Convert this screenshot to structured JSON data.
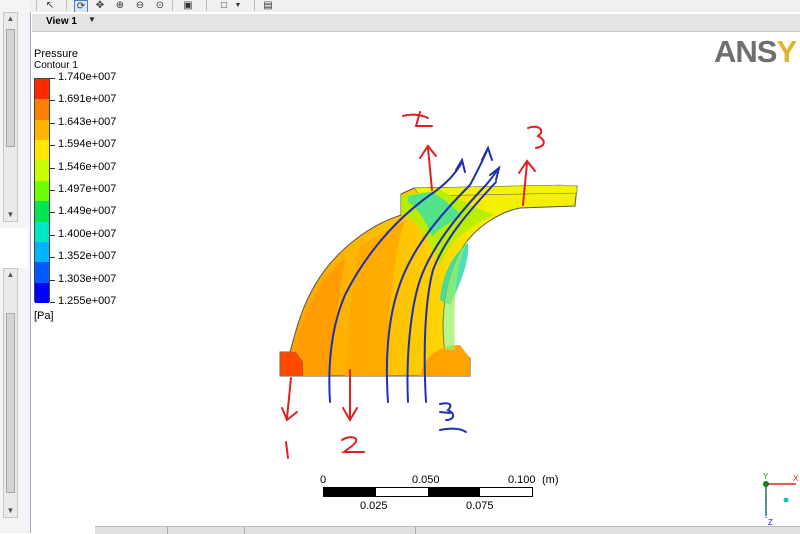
{
  "view": {
    "tab_label": "View 1"
  },
  "logo": {
    "letters_a": "ANS",
    "letters_b": "Y",
    "color_a": "#6f6f6f",
    "color_b": "#e2b32b"
  },
  "legend": {
    "title": "Pressure",
    "subtitle": "Contour 1",
    "unit": "[Pa]",
    "labels": [
      "1.740e+007",
      "1.691e+007",
      "1.643e+007",
      "1.594e+007",
      "1.546e+007",
      "1.497e+007",
      "1.449e+007",
      "1.400e+007",
      "1.352e+007",
      "1.303e+007",
      "1.255e+007"
    ],
    "colors": [
      "#ff2a00",
      "#ff7f00",
      "#ffb400",
      "#ffe600",
      "#c8ff00",
      "#6eff00",
      "#00e650",
      "#00e6c8",
      "#00b4ff",
      "#005aff",
      "#0000ff"
    ]
  },
  "scale_bar": {
    "top_labels": [
      "0",
      "0.050",
      "0.100"
    ],
    "bottom_labels": [
      "0.025",
      "0.075"
    ],
    "unit": "(m)"
  },
  "annotations": {
    "outlet_4": "4",
    "outlet_3": "3",
    "inlet_1": "1",
    "inlet_2": "2",
    "inlet_3": "3"
  },
  "axes": {
    "x": "X",
    "y": "Y",
    "z": "Z"
  },
  "colors": {
    "annotation_red": "#e02020",
    "streamline_blue": "#2030b0"
  }
}
